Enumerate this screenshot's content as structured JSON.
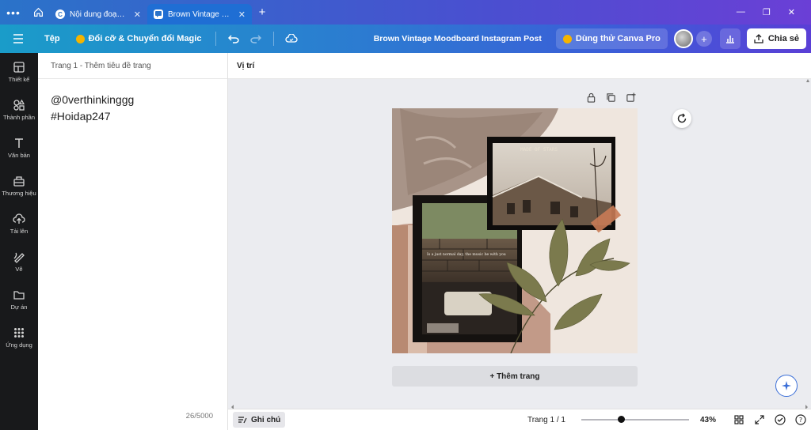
{
  "browser": {
    "tabs": [
      {
        "title": "Nội dung đoạn văn...",
        "active": false
      },
      {
        "title": "Brown Vintage Mo...",
        "active": true
      }
    ]
  },
  "toolbar": {
    "file_label": "Tệp",
    "magic_label": "Đổi cỡ & Chuyển đổi Magic",
    "doc_title": "Brown Vintage Moodboard Instagram Post",
    "pro_label": "Dùng thử Canva Pro",
    "share_label": "Chia sẻ"
  },
  "sidebar": {
    "items": [
      {
        "label": "Thiết kế",
        "icon": "layout-icon"
      },
      {
        "label": "Thành phần",
        "icon": "shapes-icon"
      },
      {
        "label": "Văn bản",
        "icon": "text-icon"
      },
      {
        "label": "Thương hiệu",
        "icon": "brand-icon"
      },
      {
        "label": "Tải lên",
        "icon": "upload-icon"
      },
      {
        "label": "Vẽ",
        "icon": "draw-icon"
      },
      {
        "label": "Dự án",
        "icon": "folder-icon"
      },
      {
        "label": "Ứng dụng",
        "icon": "apps-icon"
      }
    ]
  },
  "notes": {
    "header": "Trang 1 - Thêm tiêu đề trang",
    "lines": [
      "@0verthinkinggg",
      "#Hoidap247"
    ],
    "char_count": "26/5000"
  },
  "canvas": {
    "position_label": "Vị trí",
    "add_page_label": "+ Thêm trang",
    "design_text": {
      "polaroid_title": "MADE  OF  STARS",
      "strip_caption": "Is a just normal day, the music be with you"
    }
  },
  "bottombar": {
    "notes_label": "Ghi chú",
    "page_indicator": "Trang 1 / 1",
    "zoom": "43%",
    "zoom_fraction": 0.37
  },
  "colors": {
    "accent": "#2c7bd1",
    "rail_bg": "#18191b",
    "canvas_bg": "#ebecf0"
  }
}
